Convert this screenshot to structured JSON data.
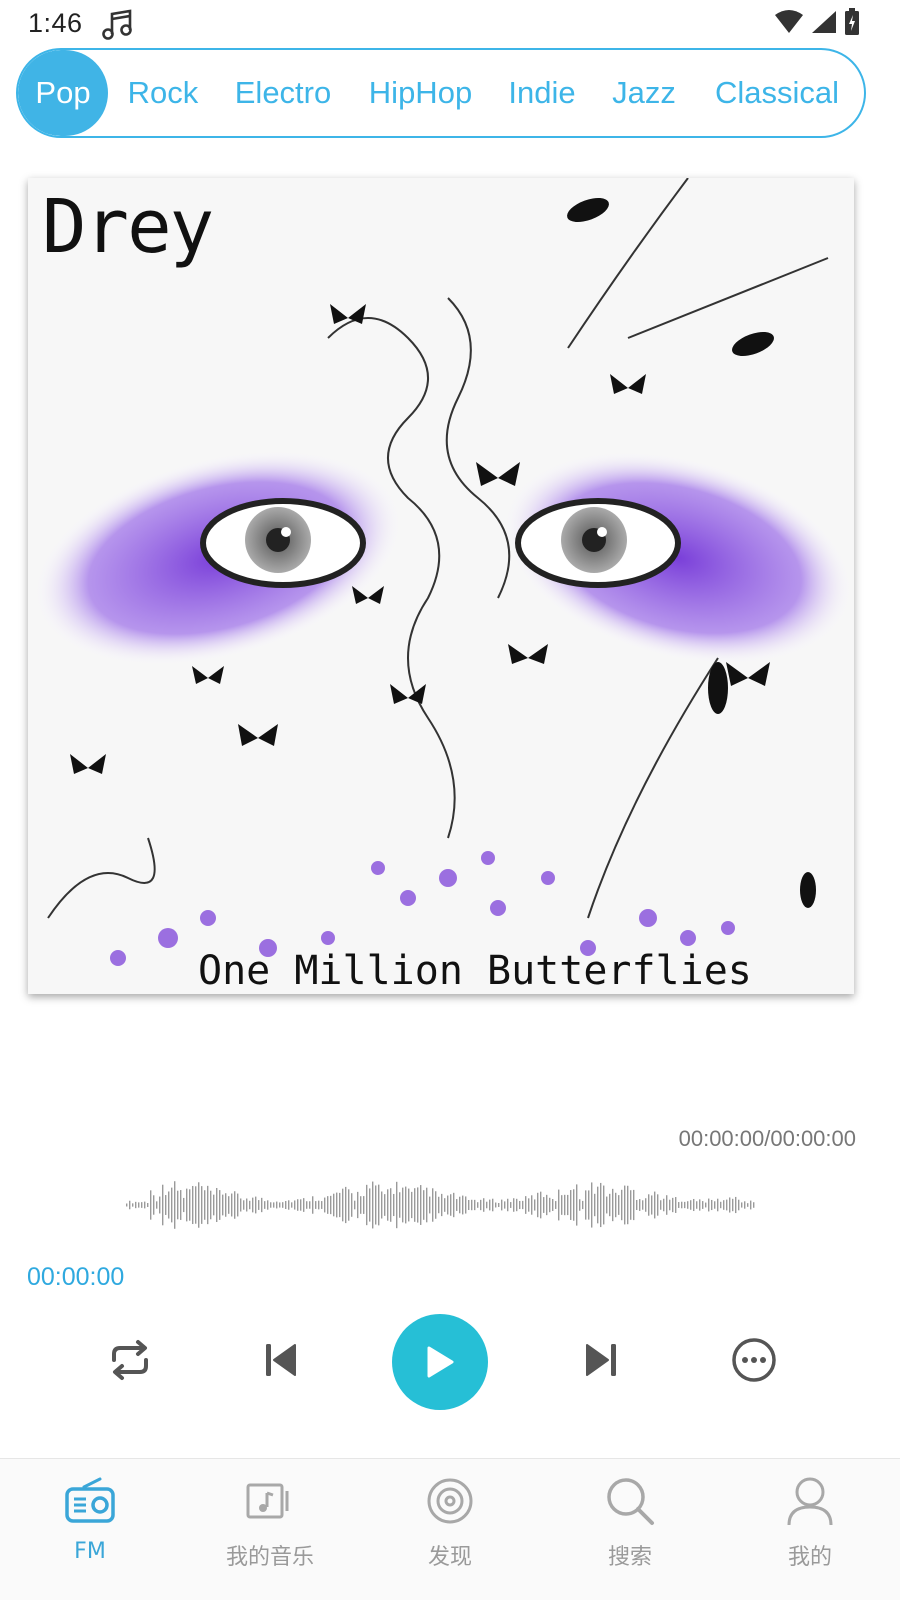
{
  "status_bar": {
    "time": "1:46",
    "icons": [
      "music-note-icon",
      "wifi-icon",
      "signal-icon",
      "battery-icon"
    ]
  },
  "genres": {
    "items": [
      "Pop",
      "Rock",
      "Electro",
      "HipHop",
      "Indie",
      "Jazz",
      "Classical"
    ],
    "selected": "Pop",
    "accent_color": "#3db5e8"
  },
  "album": {
    "artist": "Drey",
    "title": "One Million Butterflies"
  },
  "player": {
    "total_time": "00:00:00/00:00:00",
    "current_time": "00:00:00",
    "progress": 0,
    "controls": [
      "repeat-icon",
      "previous-icon",
      "play-icon",
      "next-icon",
      "more-icon"
    ],
    "play_button_color": "#26bfd6"
  },
  "bottom_nav": {
    "items": [
      {
        "label": "FM",
        "icon": "radio-icon",
        "active": true
      },
      {
        "label": "我的音乐",
        "icon": "music-box-icon",
        "active": false
      },
      {
        "label": "发现",
        "icon": "disc-icon",
        "active": false
      },
      {
        "label": "搜索",
        "icon": "search-icon",
        "active": false
      },
      {
        "label": "我的",
        "icon": "user-icon",
        "active": false
      }
    ],
    "active_color": "#3aa6d8"
  }
}
